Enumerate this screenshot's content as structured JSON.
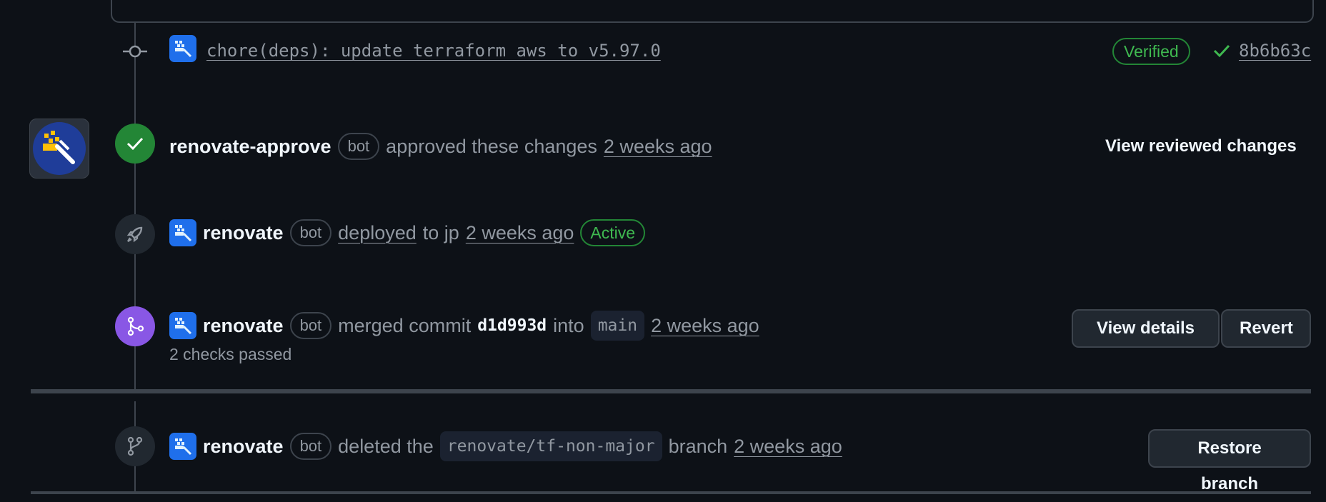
{
  "commit": {
    "message": "chore(deps): update terraform aws to v5.97.0",
    "verified": "Verified",
    "sha": "8b6b63c"
  },
  "approval": {
    "actor": "renovate-approve",
    "bot": "bot",
    "action": "approved these changes",
    "time": "2 weeks ago",
    "view_label": "View reviewed changes"
  },
  "deploy": {
    "actor": "renovate",
    "bot": "bot",
    "action": "deployed",
    "to_text": "to jp",
    "time": "2 weeks ago",
    "status": "Active"
  },
  "merge": {
    "actor": "renovate",
    "bot": "bot",
    "action": "merged commit",
    "sha": "d1d993d",
    "into": "into",
    "branch": "main",
    "time": "2 weeks ago",
    "checks": "2 checks passed",
    "view_details": "View details",
    "revert": "Revert"
  },
  "delete": {
    "actor": "renovate",
    "bot": "bot",
    "action": "deleted the",
    "branch": "renovate/tf-non-major",
    "suffix": "branch",
    "time": "2 weeks ago",
    "restore": "Restore branch"
  },
  "colors": {
    "background": "#0d1117",
    "success": "#238636",
    "merged": "#8957e5",
    "accent": "#1f6feb"
  }
}
